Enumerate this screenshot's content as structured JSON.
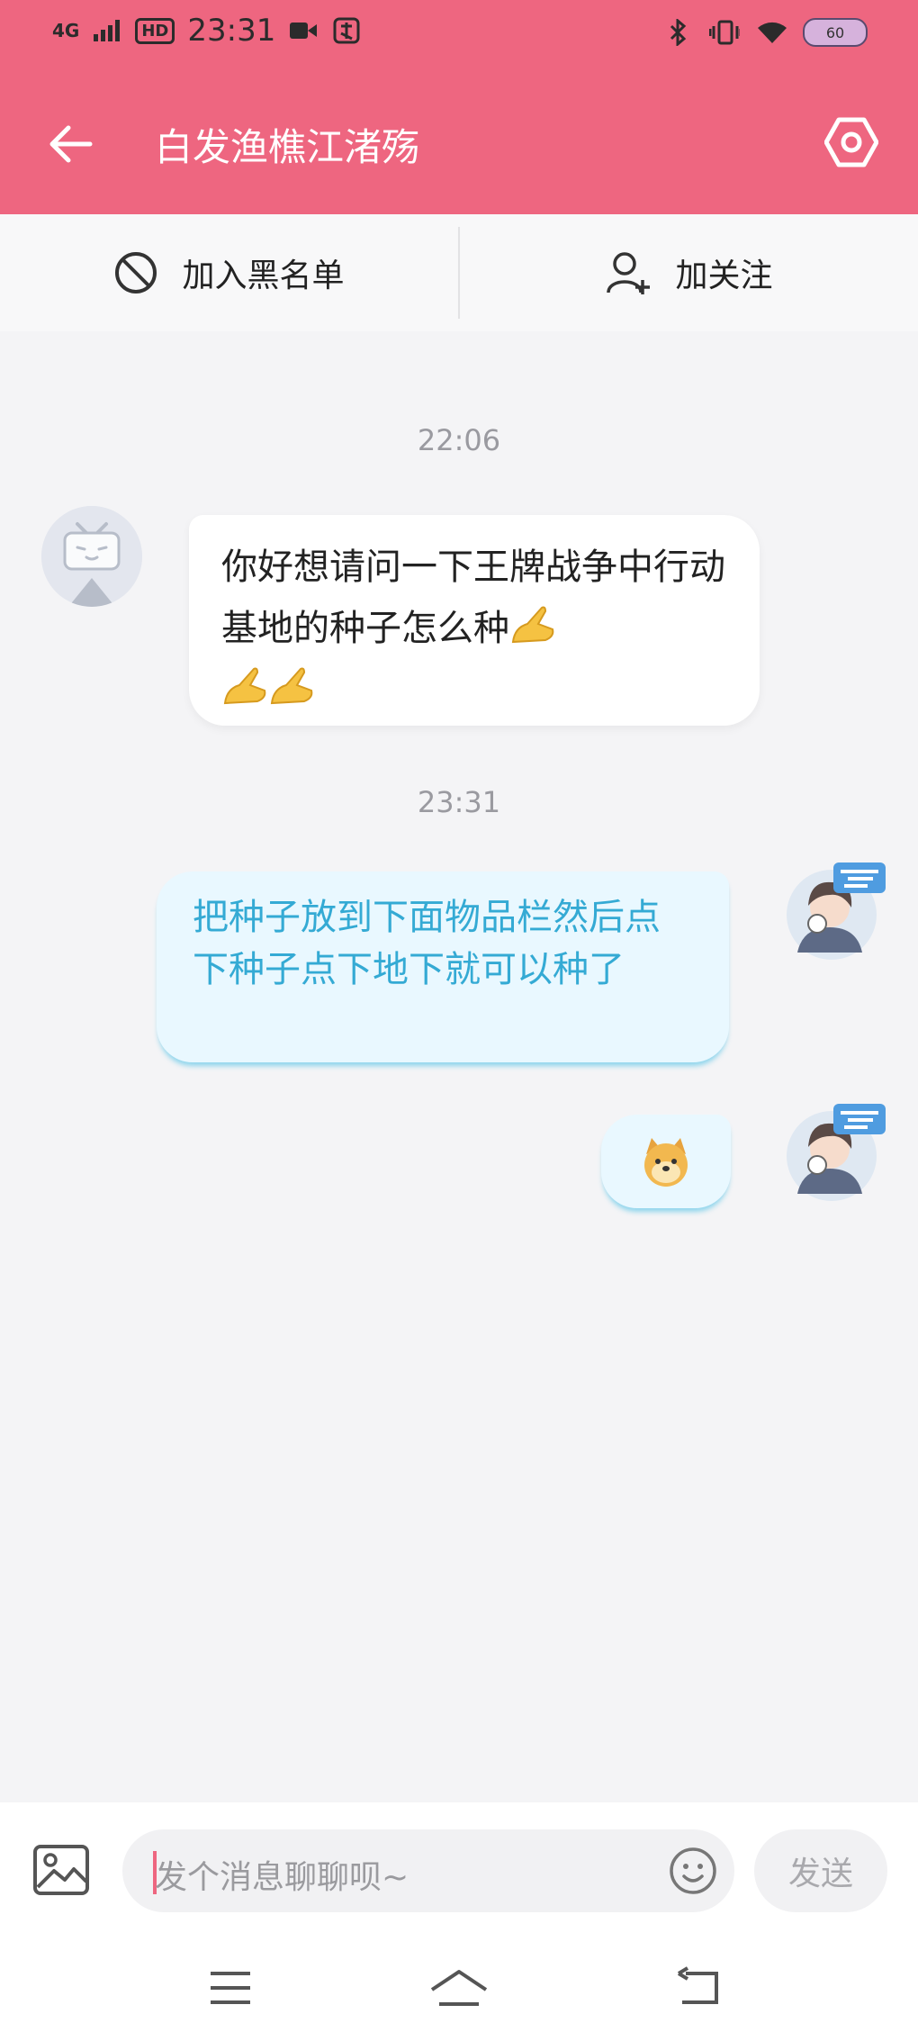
{
  "status": {
    "network": "4G",
    "hd": "HD",
    "time": "23:31",
    "battery": "60"
  },
  "header": {
    "title": "白发渔樵江渚殇"
  },
  "actions": {
    "block_label": "加入黑名单",
    "follow_label": "加关注"
  },
  "messages": {
    "time1": "22:06",
    "incoming_text": "你好想请问一下王牌战争中行动基地的种子怎么种",
    "time2": "23:31",
    "outgoing_text": "把种子放到下面物品栏然后点下种子点下地下就可以种了"
  },
  "input": {
    "placeholder": "发个消息聊聊呗~",
    "send_label": "发送"
  },
  "colors": {
    "accent": "#ee6680",
    "outgoing_bubble": "#e9f8ff",
    "outgoing_text": "#34aad4"
  }
}
